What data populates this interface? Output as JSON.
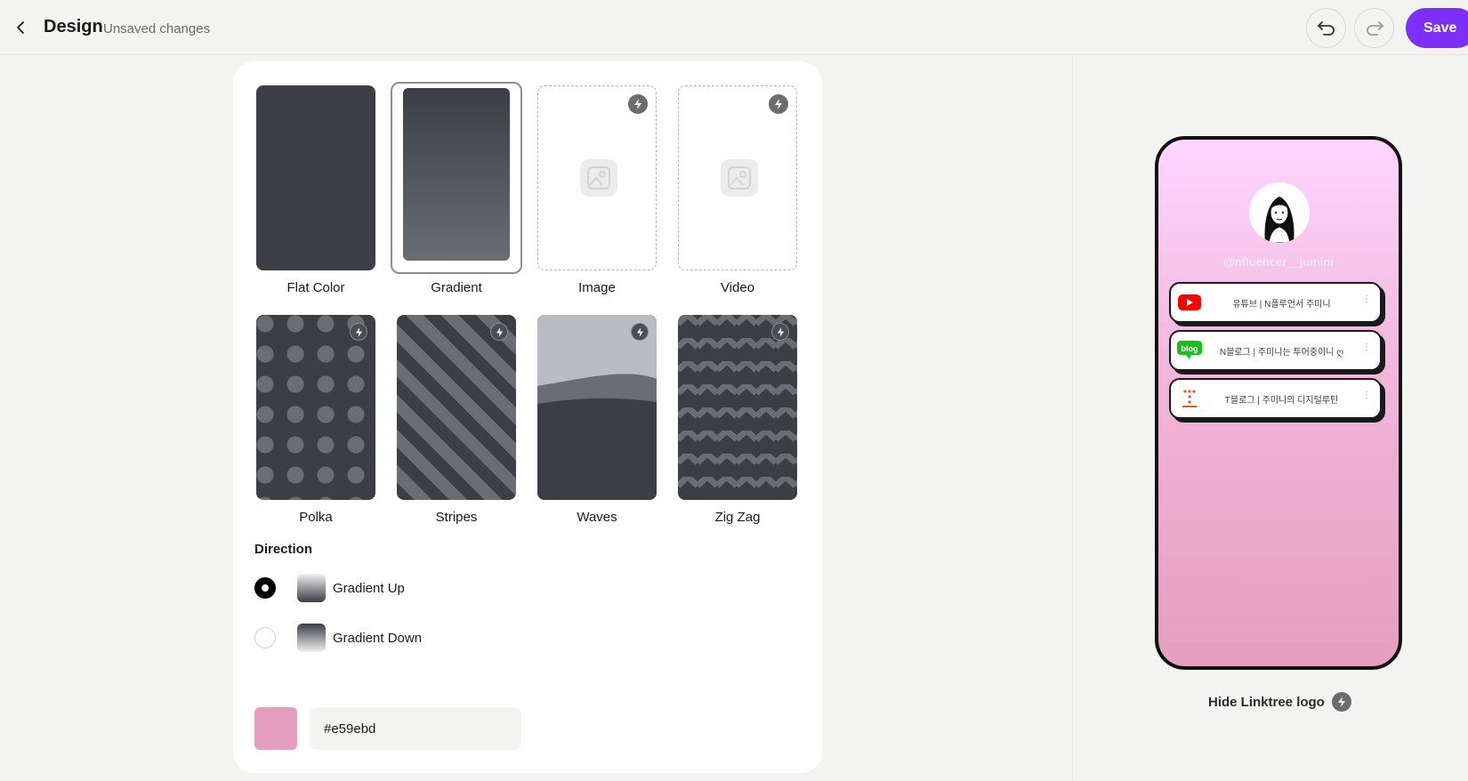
{
  "header": {
    "title": "Design",
    "subtitle": "Unsaved changes",
    "save_label": "Save"
  },
  "backgrounds": {
    "tiles": [
      {
        "label": "Flat Color",
        "premium": false
      },
      {
        "label": "Gradient",
        "premium": false,
        "selected": true
      },
      {
        "label": "Image",
        "premium": true
      },
      {
        "label": "Video",
        "premium": true
      },
      {
        "label": "Polka",
        "premium": true
      },
      {
        "label": "Stripes",
        "premium": true
      },
      {
        "label": "Waves",
        "premium": true
      },
      {
        "label": "Zig Zag",
        "premium": true
      }
    ]
  },
  "direction": {
    "title": "Direction",
    "options": [
      {
        "label": "Gradient Up",
        "selected": true
      },
      {
        "label": "Gradient Down",
        "selected": false
      }
    ]
  },
  "color": {
    "value": "#e59ebd"
  },
  "preview": {
    "handle": "@nfluencer__jumini",
    "links": [
      {
        "text": "유튜브 | N플루언서 주미니",
        "icon": "youtube-icon"
      },
      {
        "text": "N블로그 | 주미니는 투어중이니 ღ",
        "icon": "blog-icon"
      },
      {
        "text": "T블로그 | 주미니의 디지털루틴",
        "icon": "tistory-icon"
      }
    ],
    "hide_logo_label": "Hide Linktree logo"
  },
  "colors": {
    "accent": "#7b2ff7",
    "background_color": "#e59ebd",
    "tile_dark": "#3b3f45"
  }
}
